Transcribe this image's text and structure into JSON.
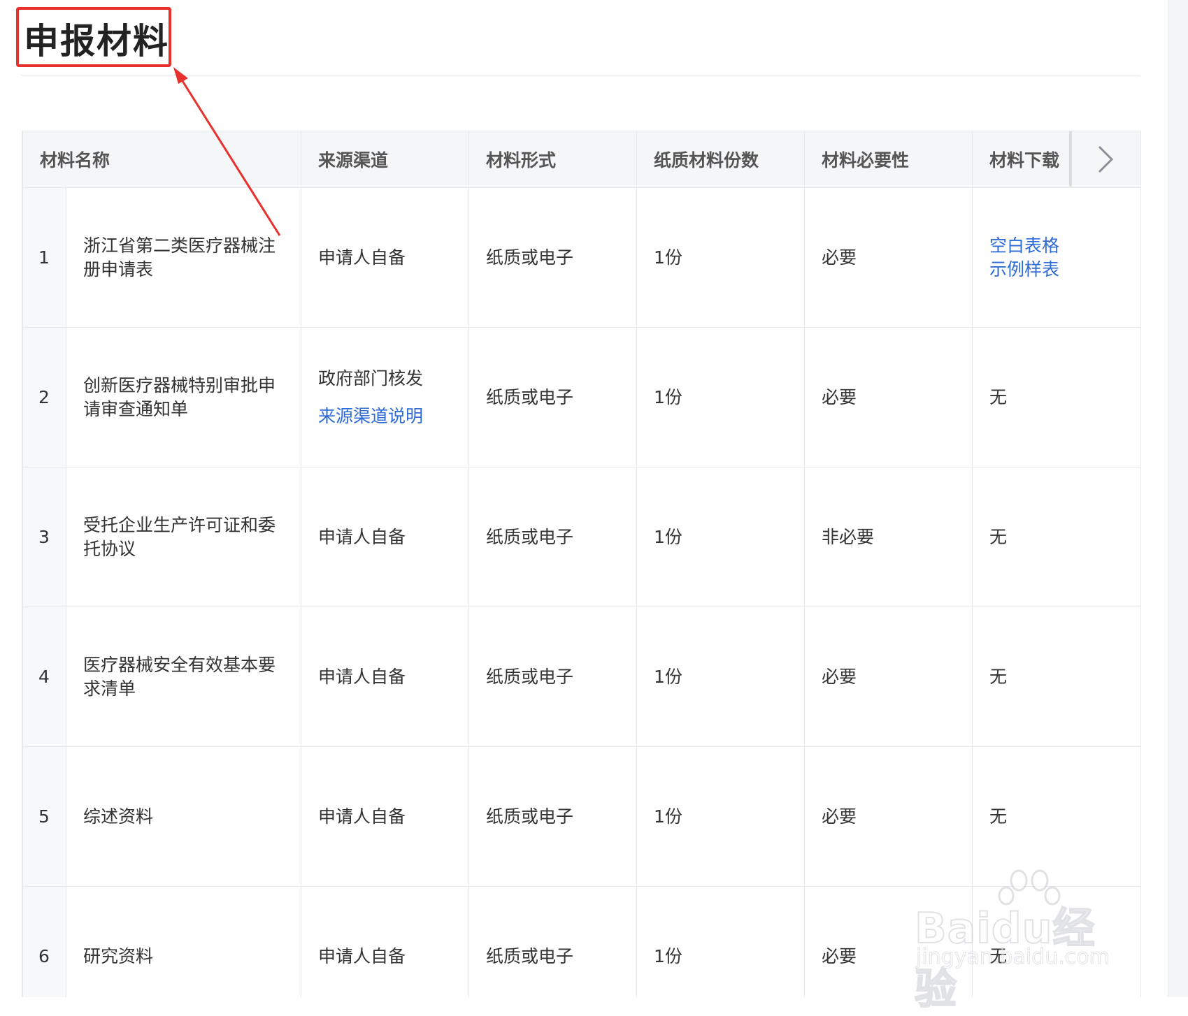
{
  "page": {
    "title": "申报材料"
  },
  "table": {
    "headers": [
      "材料名称",
      "来源渠道",
      "材料形式",
      "纸质材料份数",
      "材料必要性",
      "材料下载"
    ],
    "rows": [
      {
        "index": "1",
        "name": "浙江省第二类医疗器械注册申请表",
        "source": "申请人自备",
        "source_link": "",
        "form": "纸质或电子",
        "copies": "1份",
        "necessity": "必要",
        "download": "",
        "download_links": [
          "空白表格",
          "示例样表"
        ]
      },
      {
        "index": "2",
        "name": "创新医疗器械特别审批申请审查通知单",
        "source": "政府部门核发",
        "source_link": "来源渠道说明",
        "form": "纸质或电子",
        "copies": "1份",
        "necessity": "必要",
        "download": "无",
        "download_links": []
      },
      {
        "index": "3",
        "name": "受托企业生产许可证和委托协议",
        "source": "申请人自备",
        "source_link": "",
        "form": "纸质或电子",
        "copies": "1份",
        "necessity": "非必要",
        "download": "无",
        "download_links": []
      },
      {
        "index": "4",
        "name": "医疗器械安全有效基本要求清单",
        "source": "申请人自备",
        "source_link": "",
        "form": "纸质或电子",
        "copies": "1份",
        "necessity": "必要",
        "download": "无",
        "download_links": []
      },
      {
        "index": "5",
        "name": "综述资料",
        "source": "申请人自备",
        "source_link": "",
        "form": "纸质或电子",
        "copies": "1份",
        "necessity": "必要",
        "download": "无",
        "download_links": []
      },
      {
        "index": "6",
        "name": "研究资料",
        "source": "申请人自备",
        "source_link": "",
        "form": "纸质或电子",
        "copies": "1份",
        "necessity": "必要",
        "download": "无",
        "download_links": []
      }
    ]
  },
  "nav": {
    "icon": "chevron-right-icon"
  },
  "watermark": {
    "brand": "Baidu经验",
    "url": "jingyan.baidu.com"
  },
  "colors": {
    "link": "#2e6bd6",
    "highlight": "#e8302d",
    "header_bg": "#f5f6f8"
  }
}
